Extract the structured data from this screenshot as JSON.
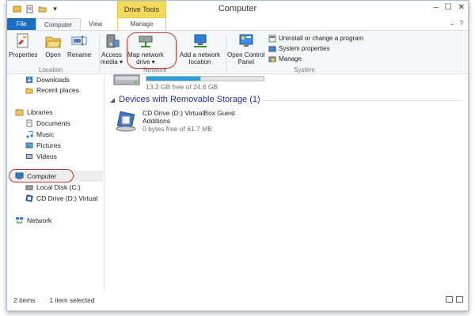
{
  "window": {
    "title": "Computer",
    "context_tab": "Drive Tools"
  },
  "tabs": [
    {
      "label": "File"
    },
    {
      "label": "Computer"
    },
    {
      "label": "View"
    },
    {
      "label": "Manage"
    }
  ],
  "ribbon": {
    "location_buttons": [
      {
        "label": "Properties"
      },
      {
        "label": "Open"
      },
      {
        "label": "Rename"
      }
    ],
    "location_label": "Location",
    "network_buttons": [
      {
        "label_line1": "Access",
        "label_line2": "media ▾"
      },
      {
        "label_line1": "Map network",
        "label_line2": "drive ▾"
      },
      {
        "label_line1": "Add a network",
        "label_line2": "location"
      }
    ],
    "network_label": "Network",
    "control_panel": {
      "label_line1": "Open Control",
      "label_line2": "Panel"
    },
    "system_items": [
      {
        "label": "Uninstall or change a program"
      },
      {
        "label": "System properties"
      },
      {
        "label": "Manage"
      }
    ],
    "system_label": "System"
  },
  "nav": {
    "items": [
      {
        "label": "Downloads"
      },
      {
        "label": "Recent places"
      },
      {
        "label": "Libraries"
      },
      {
        "label": "Documents"
      },
      {
        "label": "Music"
      },
      {
        "label": "Pictures"
      },
      {
        "label": "Videos"
      },
      {
        "label": "Computer"
      },
      {
        "label": "Local Disk (C:)"
      },
      {
        "label": "CD Drive (D:) Virtual"
      },
      {
        "label": "Network"
      }
    ]
  },
  "content": {
    "local_disk_free": "13.2 GB free of 24.6 GB",
    "section_title": "Devices with Removable Storage (1)",
    "cd_drive": {
      "name_line1": "CD Drive (D:) VirtualBox Guest",
      "name_line2": "Additions",
      "free": "0 bytes free of 61.7 MB"
    }
  },
  "status": {
    "count": "2 items",
    "selection": "1 item selected"
  },
  "colors": {
    "file_tab": "#1a6fc2",
    "context_tab": "#f3da5a",
    "highlight_circle": "#c0392b",
    "section_title": "#1e3287"
  }
}
